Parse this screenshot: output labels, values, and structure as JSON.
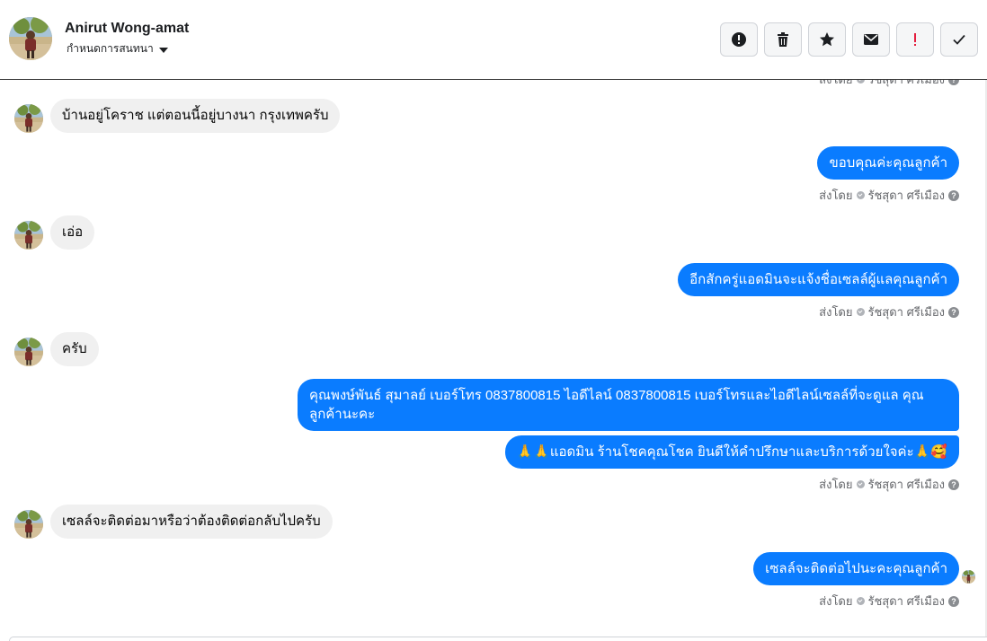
{
  "header": {
    "contact_name": "Anirut Wong-amat",
    "assign_label": "กำหนดการสนทนา",
    "actions": [
      {
        "name": "report-button",
        "icon": "alert-circle-icon"
      },
      {
        "name": "delete-button",
        "icon": "trash-icon"
      },
      {
        "name": "star-button",
        "icon": "star-icon"
      },
      {
        "name": "mark-unread-button",
        "icon": "envelope-icon"
      },
      {
        "name": "flag-button",
        "icon": "exclamation-icon"
      },
      {
        "name": "mark-done-button",
        "icon": "checkmark-icon"
      }
    ]
  },
  "messages": {
    "top_sent_by": "ส่งโดย",
    "top_sender": "รัชสุดา ศรีเมือง",
    "m1": "บ้านอยู่โคราช แต่ตอนนี้อยู่บางนา กรุงเทพครับ",
    "m2": "ขอบคุณค่ะคุณลูกค้า",
    "m3": "เอ่อ",
    "m4": "อีกสักครู่แอดมินจะแจ้งชื่อเซลล์ผู้แลคุณลูกค้า",
    "m5": "ครับ",
    "m6": "คุณพงษ์พันธ์ สุมาลย์     เบอร์โทร 0837800815  ไอดีไลน์ 0837800815   เบอร์โทรและไอดีไลน์เซลล์ที่จะดูแล คุณลูกค้านะคะ",
    "m7": "🙏🙏แอดมิน ร้านโชคคุณโชค ยินดีให้คำปรึกษาและบริการด้วยใจค่ะ🙏🥰",
    "m8": "เซลล์จะติดต่อมาหรือว่าต้องติดต่อกลับไปครับ",
    "m9": "เซลล์จะติดต่อไปนะคะคุณลูกค้า",
    "sent_by_label": "ส่งโดย",
    "sender_name": "รัชสุดา ศรีเมือง"
  },
  "colors": {
    "outgoing_bubble": "#0a7cff",
    "incoming_bubble": "#f0f0f0",
    "flag_red": "#e41e3f"
  }
}
